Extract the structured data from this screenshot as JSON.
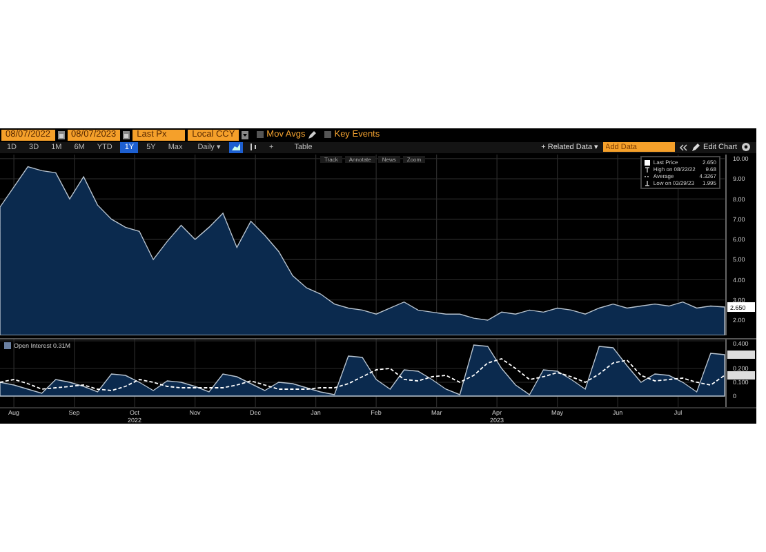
{
  "toolbar": {
    "start_date": "08/07/2022",
    "end_date": "08/07/2023",
    "field": "Last Px",
    "currency": "Local CCY",
    "options": [
      {
        "label": "Mov Avgs",
        "checked": false
      },
      {
        "label": "Key Events",
        "checked": false
      }
    ]
  },
  "range_buttons": [
    {
      "label": "1D",
      "selected": false
    },
    {
      "label": "3D",
      "selected": false
    },
    {
      "label": "1M",
      "selected": false
    },
    {
      "label": "6M",
      "selected": false
    },
    {
      "label": "YTD",
      "selected": false
    },
    {
      "label": "1Y",
      "selected": true
    },
    {
      "label": "5Y",
      "selected": false
    },
    {
      "label": "Max",
      "selected": false
    }
  ],
  "frequency": "Daily ▾",
  "chart_type_buttons": [
    {
      "kind": "area",
      "selected": true
    },
    {
      "kind": "candle",
      "selected": false
    }
  ],
  "add_button": "+",
  "table_button": "Table",
  "related_data": "+ Related Data ▾",
  "add_data_placeholder": "Add Data",
  "edit_chart": "Edit Chart",
  "chart_tools": [
    "Track",
    "Annotate",
    "News",
    "Zoom"
  ],
  "price_chart": {
    "legend": [
      {
        "kind": "last",
        "label": "Last Price",
        "value": "2.650"
      },
      {
        "kind": "high",
        "label": "High on 08/22/22",
        "value": "9.68"
      },
      {
        "kind": "average",
        "label": "Average",
        "value": "4.3267"
      },
      {
        "kind": "low",
        "label": "Low on 03/29/23",
        "value": "1.995"
      }
    ],
    "last_price_tag": "2.650",
    "chart_data": {
      "type": "area",
      "grid": true,
      "series": [
        {
          "color": "#0b2a4e",
          "values": [
            7.6,
            8.6,
            9.6,
            9.4,
            9.3,
            8.0,
            9.1,
            7.7,
            7.0,
            6.6,
            6.4,
            5.0,
            5.9,
            6.7,
            6.0,
            6.6,
            7.3,
            5.6,
            6.9,
            6.2,
            5.4,
            4.2,
            3.6,
            3.3,
            2.8,
            2.6,
            2.5,
            2.3,
            2.6,
            2.9,
            2.5,
            2.4,
            2.3,
            2.3,
            2.1,
            2.0,
            2.4,
            2.3,
            2.5,
            2.4,
            2.6,
            2.5,
            2.3,
            2.6,
            2.8,
            2.6,
            2.7,
            2.8,
            2.7,
            2.9,
            2.6,
            2.7,
            2.65
          ]
        }
      ],
      "ylim": [
        1.25,
        10.2
      ],
      "yticks": [
        {
          "value": 2,
          "label": "2.00"
        },
        {
          "value": 3,
          "label": "3.00"
        },
        {
          "value": 4,
          "label": "4.00"
        },
        {
          "value": 5,
          "label": "5.00"
        },
        {
          "value": 6,
          "label": "6.00"
        },
        {
          "value": 7,
          "label": "7.00"
        },
        {
          "value": 8,
          "label": "8.00"
        },
        {
          "value": 9,
          "label": "9.00"
        },
        {
          "value": 10,
          "label": "10.00"
        }
      ]
    }
  },
  "open_interest_chart": {
    "legend_value": "0.31M",
    "chart_data": {
      "type": "area",
      "grid": true,
      "series": [
        {
          "name": "Open Interest",
          "color": "#0b2a4e",
          "values": [
            0.1,
            0.08,
            0.05,
            0.02,
            0.12,
            0.1,
            0.07,
            0.03,
            0.16,
            0.15,
            0.1,
            0.04,
            0.11,
            0.1,
            0.07,
            0.03,
            0.16,
            0.14,
            0.09,
            0.04,
            0.1,
            0.09,
            0.06,
            0.03,
            0.01,
            0.29,
            0.28,
            0.12,
            0.05,
            0.19,
            0.18,
            0.12,
            0.05,
            0.01,
            0.37,
            0.36,
            0.2,
            0.08,
            0.01,
            0.19,
            0.18,
            0.12,
            0.05,
            0.36,
            0.35,
            0.22,
            0.1,
            0.16,
            0.15,
            0.1,
            0.03,
            0.31,
            0.3
          ]
        },
        {
          "type": "line",
          "line_style": "dashed",
          "color": "#ffffff",
          "values": [
            0.1,
            0.12,
            0.09,
            0.05,
            0.06,
            0.07,
            0.08,
            0.05,
            0.04,
            0.07,
            0.12,
            0.1,
            0.07,
            0.06,
            0.06,
            0.06,
            0.06,
            0.08,
            0.11,
            0.08,
            0.05,
            0.05,
            0.05,
            0.06,
            0.06,
            0.09,
            0.14,
            0.19,
            0.2,
            0.12,
            0.11,
            0.14,
            0.15,
            0.1,
            0.15,
            0.24,
            0.27,
            0.2,
            0.12,
            0.14,
            0.17,
            0.14,
            0.1,
            0.16,
            0.24,
            0.26,
            0.15,
            0.11,
            0.12,
            0.13,
            0.1,
            0.08,
            0.15
          ]
        }
      ],
      "ylim": [
        -0.08,
        0.41
      ],
      "yticks": [
        {
          "value": 0,
          "label": "0"
        },
        {
          "value": 0.1,
          "label": "0.100"
        },
        {
          "value": 0.2,
          "label": "0.200"
        },
        {
          "value": 0.4,
          "label": "0.400"
        }
      ]
    },
    "months": [
      "Aug",
      "Sep",
      "Oct",
      "Nov",
      "Dec",
      "Jan",
      "Feb",
      "Mar",
      "Apr",
      "May",
      "Jun",
      "Jul"
    ],
    "years": [
      "2022",
      "2023"
    ]
  }
}
